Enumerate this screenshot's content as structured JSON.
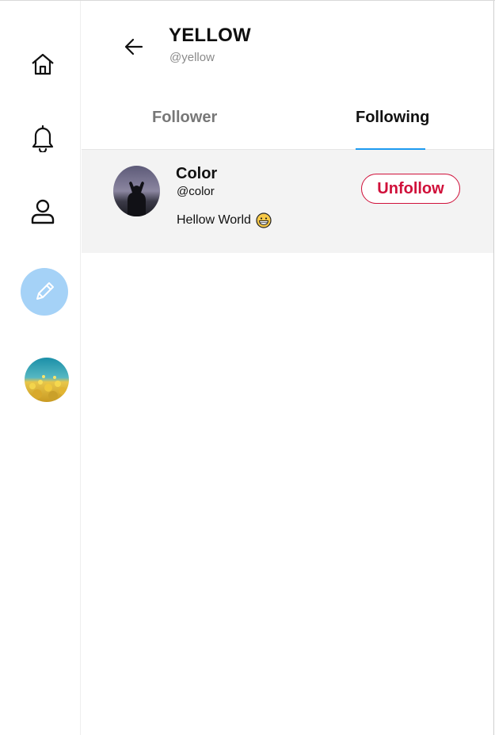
{
  "sidebar": {
    "items": [
      {
        "name": "home",
        "icon": "home-icon"
      },
      {
        "name": "notifications",
        "icon": "bell-icon"
      },
      {
        "name": "profile",
        "icon": "user-icon"
      }
    ],
    "compose": {
      "icon": "pencil-icon",
      "color": "#a5d2f7"
    },
    "avatar": {
      "description_icon": "yellow-flower-field-avatar"
    }
  },
  "header": {
    "back_icon": "arrow-left-icon",
    "name": "YELLOW",
    "handle": "@yellow"
  },
  "tabs": [
    {
      "label": "Follower",
      "active": false
    },
    {
      "label": "Following",
      "active": true
    }
  ],
  "following_list": [
    {
      "name": "Color",
      "handle": "@color",
      "bio": "Hellow World",
      "bio_emoji": "grinning-face-icon",
      "action_label": "Unfollow"
    }
  ],
  "colors": {
    "accent": "#1d9bf0",
    "unfollow": "#d0103a",
    "row_background": "#f3f3f3",
    "compose_background": "#a5d2f7"
  }
}
